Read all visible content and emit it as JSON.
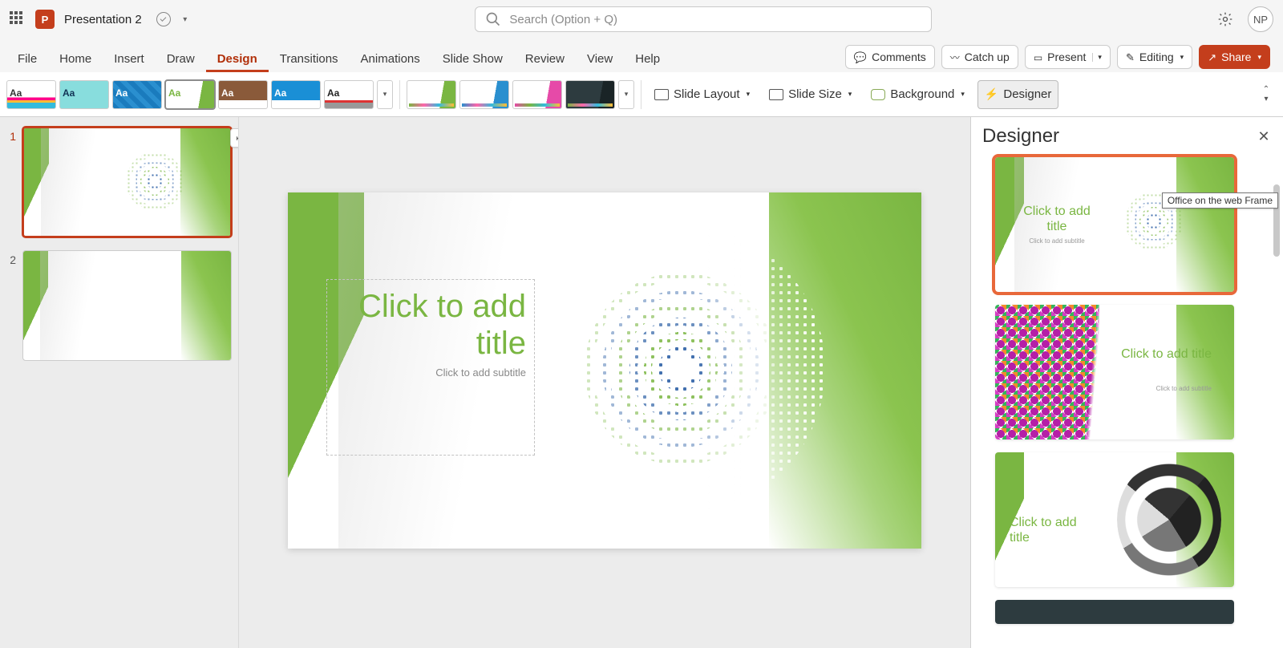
{
  "titlebar": {
    "doc_name": "Presentation 2",
    "search_placeholder": "Search (Option + Q)",
    "user_initials": "NP"
  },
  "tabs": {
    "items": [
      "File",
      "Home",
      "Insert",
      "Draw",
      "Design",
      "Transitions",
      "Animations",
      "Slide Show",
      "Review",
      "View",
      "Help"
    ],
    "active": "Design",
    "right": {
      "comments": "Comments",
      "catchup": "Catch up",
      "present": "Present",
      "editing": "Editing",
      "share": "Share"
    }
  },
  "ribbon": {
    "slide_layout": "Slide Layout",
    "slide_size": "Slide Size",
    "background": "Background",
    "designer": "Designer"
  },
  "slides": {
    "count": 2,
    "selected": 1,
    "labels": [
      "1",
      "2"
    ]
  },
  "canvas": {
    "title_placeholder": "Click to add title",
    "subtitle_placeholder": "Click to add subtitle"
  },
  "designer_pane": {
    "title": "Designer",
    "tooltip": "Office on the web Frame",
    "cards": [
      {
        "title": "Click to add title",
        "subtitle": "Click to add subtitle"
      },
      {
        "title": "Click to add title",
        "subtitle": "Click to add subtitle"
      },
      {
        "title": "Click to add title",
        "subtitle": ""
      }
    ]
  }
}
